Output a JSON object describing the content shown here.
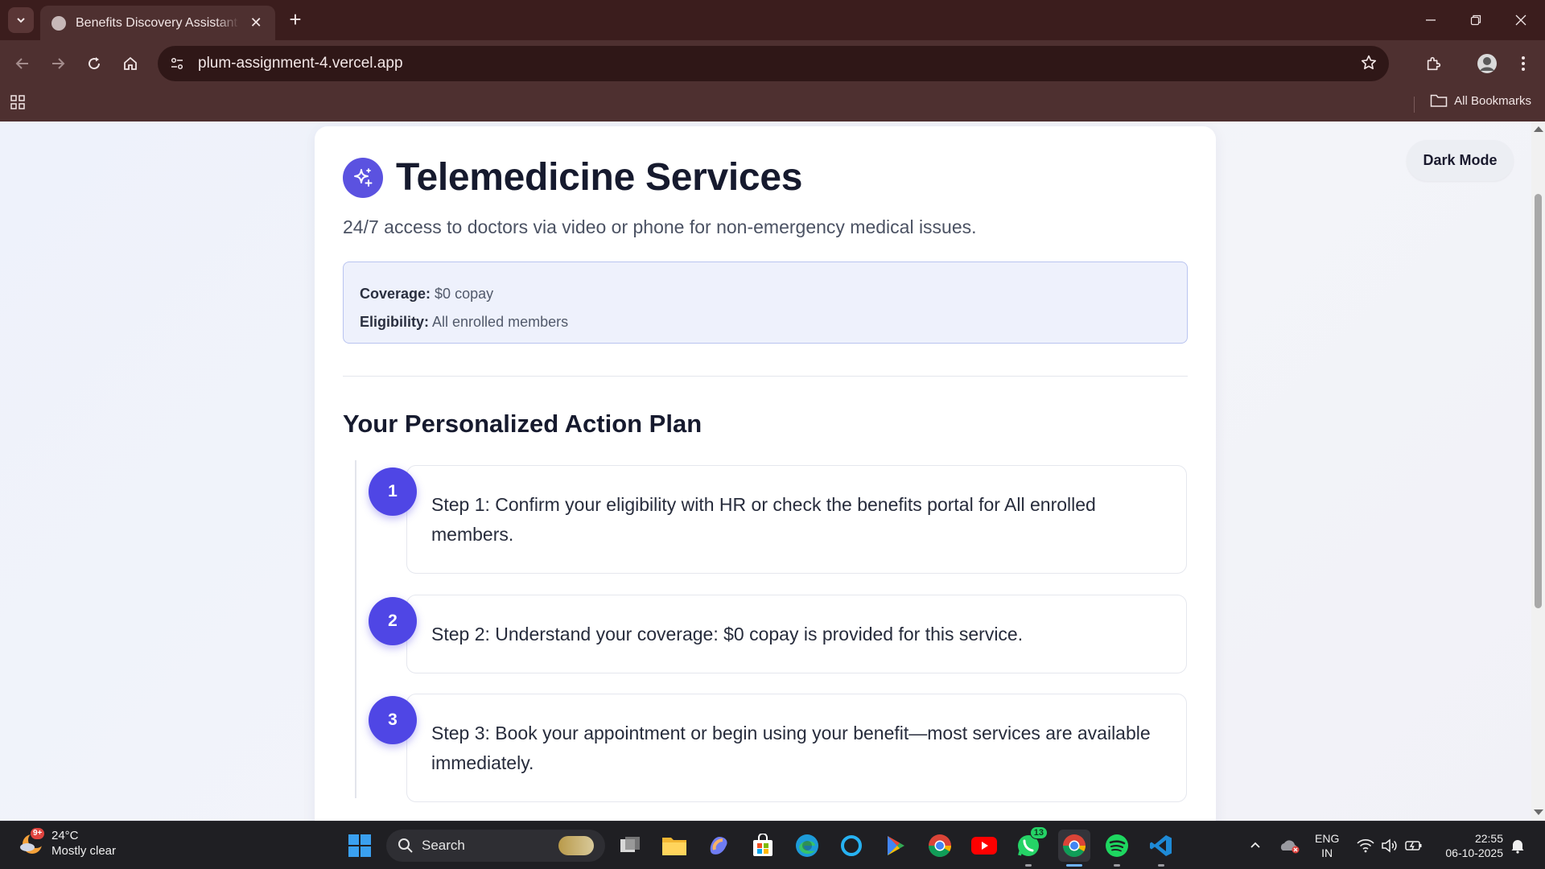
{
  "browser": {
    "tab_title": "Benefits Discovery Assistant | AI",
    "url": "plum-assignment-4.vercel.app",
    "all_bookmarks_label": "All Bookmarks"
  },
  "page": {
    "dark_mode_label": "Dark Mode",
    "benefit": {
      "title": "Telemedicine Services",
      "description": "24/7 access to doctors via video or phone for non-emergency medical issues.",
      "coverage_label": "Coverage:",
      "coverage_value": "$0 copay",
      "eligibility_label": "Eligibility:",
      "eligibility_value": "All enrolled members"
    },
    "action_plan": {
      "title": "Your Personalized Action Plan",
      "steps": [
        {
          "number": "1",
          "text": "Step 1: Confirm your eligibility with HR or check the benefits portal for All enrolled members."
        },
        {
          "number": "2",
          "text": "Step 2: Understand your coverage: $0 copay is provided for this service."
        },
        {
          "number": "3",
          "text": "Step 3: Book your appointment or begin using your benefit—most services are available immediately."
        }
      ]
    }
  },
  "taskbar": {
    "weather_temp": "24°C",
    "weather_desc": "Mostly clear",
    "weather_badge": "9+",
    "search_label": "Search",
    "whatsapp_badge": "13",
    "lang_line1": "ENG",
    "lang_line2": "IN",
    "time": "22:55",
    "date": "06-10-2025"
  },
  "colors": {
    "chrome_frame": "#3b1d1d",
    "chrome_toolbar": "#4e3030",
    "accent": "#4f46e5",
    "info_box_bg": "#eef1fc",
    "taskbar_bg": "#1f1f23"
  },
  "icons": [
    "tab-list-icon",
    "globe-favicon-icon",
    "close-icon",
    "plus-icon",
    "minimize-icon",
    "restore-icon",
    "back-icon",
    "forward-icon",
    "reload-icon",
    "home-icon",
    "site-info-icon",
    "star-icon",
    "extensions-icon",
    "profile-icon",
    "kebab-menu-icon",
    "apps-grid-icon",
    "folder-icon",
    "sparkle-icon",
    "windows-start-icon",
    "search-icon",
    "task-view-icon",
    "file-explorer-icon",
    "copilot-icon",
    "store-icon",
    "edge-icon",
    "cortana-icon",
    "play-store-icon",
    "chrome-icon",
    "youtube-icon",
    "whatsapp-icon",
    "spotify-icon",
    "vscode-icon",
    "chevron-up-icon",
    "onedrive-icon",
    "wifi-icon",
    "volume-icon",
    "battery-icon",
    "notifications-icon"
  ]
}
